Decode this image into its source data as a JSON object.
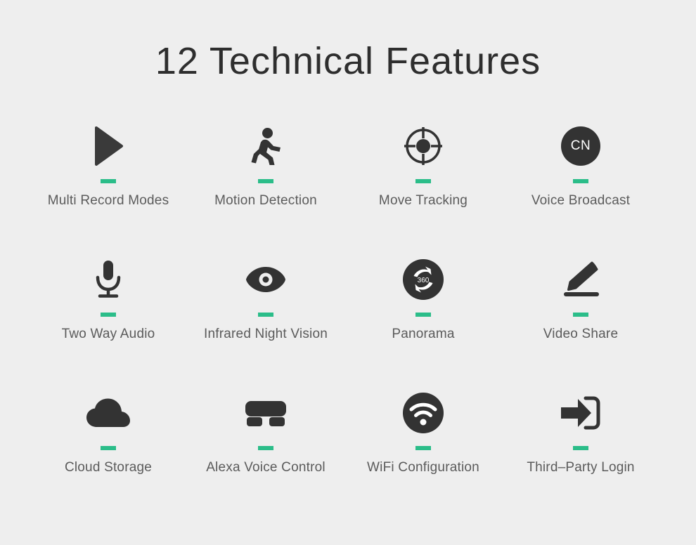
{
  "page": {
    "title": "12 Technical Features",
    "background_color": "#eeeeee",
    "accent_color": "#2bbd89",
    "icon_color": "#333333",
    "label_color": "#5b5b5b",
    "title_color": "#2e2e2e"
  },
  "features": [
    {
      "label": "Multi Record Modes",
      "icon": "play-triangle-icon"
    },
    {
      "label": "Motion Detection",
      "icon": "running-person-icon"
    },
    {
      "label": "Move Tracking",
      "icon": "crosshair-target-icon"
    },
    {
      "label": "Voice Broadcast",
      "icon": "cn-badge-icon",
      "badge_text": "CN"
    },
    {
      "label": "Two Way Audio",
      "icon": "microphone-icon"
    },
    {
      "label": "Infrared Night Vision",
      "icon": "eye-icon"
    },
    {
      "label": "Panorama",
      "icon": "panorama-360-icon",
      "badge_text": "360"
    },
    {
      "label": "Video Share",
      "icon": "pencil-edit-icon"
    },
    {
      "label": "Cloud Storage",
      "icon": "cloud-icon"
    },
    {
      "label": "Alexa Voice Control",
      "icon": "alexa-device-icon"
    },
    {
      "label": "WiFi Configuration",
      "icon": "wifi-icon"
    },
    {
      "label": "Third–Party Login",
      "icon": "login-arrow-icon"
    }
  ]
}
